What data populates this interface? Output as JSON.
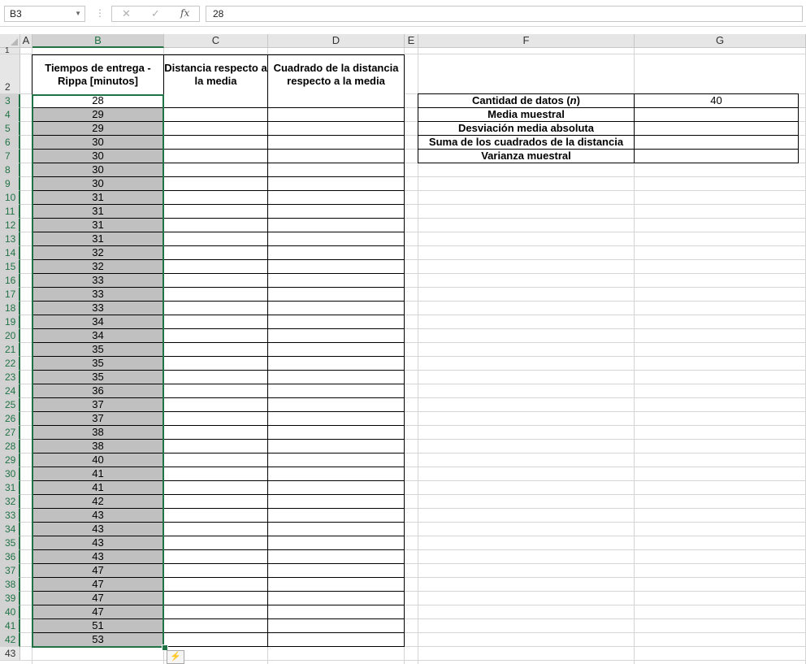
{
  "formula_bar": {
    "name_box": "B3",
    "cancel_glyph": "✕",
    "enter_glyph": "✓",
    "fx_label": "fx",
    "value": "28"
  },
  "columns": [
    "A",
    "B",
    "C",
    "D",
    "E",
    "F",
    "G"
  ],
  "selected_column": "B",
  "rows": [
    "1",
    "2",
    "3",
    "4",
    "5",
    "6",
    "7",
    "8",
    "9",
    "10",
    "11",
    "12",
    "13",
    "14",
    "15",
    "16",
    "17",
    "18",
    "19",
    "20",
    "21",
    "22",
    "23",
    "24",
    "25",
    "26",
    "27",
    "28",
    "29",
    "30",
    "31",
    "32",
    "33",
    "34",
    "35",
    "36",
    "37",
    "38",
    "39",
    "40",
    "41",
    "42",
    "43"
  ],
  "table": {
    "headers": [
      "Tiempos de entrega - Rippa [minutos]",
      "Distancia respecto a la media",
      "Cuadrado de la distancia respecto a la media"
    ],
    "values": [
      "28",
      "29",
      "29",
      "30",
      "30",
      "30",
      "30",
      "31",
      "31",
      "31",
      "31",
      "32",
      "32",
      "33",
      "33",
      "33",
      "34",
      "34",
      "35",
      "35",
      "35",
      "36",
      "37",
      "37",
      "38",
      "38",
      "40",
      "41",
      "41",
      "42",
      "43",
      "43",
      "43",
      "43",
      "47",
      "47",
      "47",
      "47",
      "51",
      "53"
    ]
  },
  "summary": {
    "labels": [
      "Cantidad de datos (n)",
      "Media muestral",
      "Desviación media absoluta",
      "Suma de los cuadrados de la distancia",
      "Varianza muestral"
    ],
    "values": [
      "40",
      "",
      "",
      "",
      ""
    ]
  },
  "colors": {
    "selection": "#217346",
    "data_fill": "#c0c0c0",
    "header_bg": "#e6e6e6",
    "gridline": "#d4d4d4"
  },
  "icons": {
    "name_box_dropdown": "chevron-down-icon",
    "quick_analysis": "quick-analysis-icon"
  }
}
